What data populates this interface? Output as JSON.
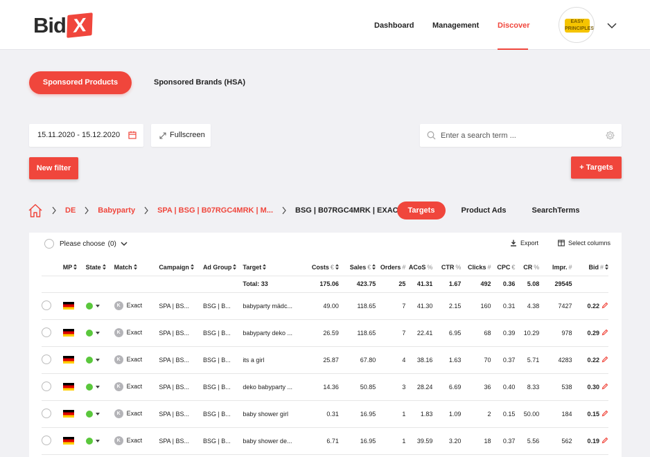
{
  "brand": {
    "name": "Bid",
    "mark": "X"
  },
  "nav": {
    "dashboard": "Dashboard",
    "management": "Management",
    "discover": "Discover"
  },
  "avatar": {
    "label": "EASY PRINCIPLES"
  },
  "pills": {
    "sponsored_products": "Sponsored Products",
    "sponsored_brands": "Sponsored Brands (HSA)"
  },
  "filters": {
    "date_range": "15.11.2020 - 15.12.2020",
    "fullscreen": "Fullscreen"
  },
  "search": {
    "placeholder": "Enter a search term ..."
  },
  "buttons": {
    "new_filter": "New filter",
    "add_targets": "+ Targets"
  },
  "breadcrumb": [
    "DE",
    "Babyparty",
    "SPA | BSG | B07RGC4MRK | M...",
    "BSG | B07RGC4MRK | EXACT"
  ],
  "tabs": {
    "targets": "Targets",
    "product_ads": "Product Ads",
    "search_terms": "SearchTerms"
  },
  "table_tools": {
    "choose": "Please choose",
    "choose_count": "(0)",
    "export": "Export",
    "select_columns": "Select columns"
  },
  "table": {
    "headers": {
      "mp": "MP",
      "state": "State",
      "match": "Match",
      "campaign": "Campaign",
      "ad_group": "Ad Group",
      "target": "Target",
      "costs": "Costs",
      "costs_unit": "€",
      "sales": "Sales",
      "sales_unit": "€",
      "orders": "Orders",
      "orders_unit": "#",
      "acos": "ACoS",
      "acos_unit": "%",
      "ctr": "CTR",
      "ctr_unit": "%",
      "clicks": "Clicks",
      "clicks_unit": "#",
      "cpc": "CPC",
      "cpc_unit": "€",
      "cr": "CR",
      "cr_unit": "%",
      "impr": "Impr.",
      "impr_unit": "#",
      "bid": "Bid",
      "bid_unit": "#"
    },
    "total": {
      "label": "Total: 33",
      "costs": "175.06",
      "sales": "423.75",
      "orders": "25",
      "acos": "41.31",
      "ctr": "1.67",
      "clicks": "492",
      "cpc": "0.36",
      "cr": "5.08",
      "impr": "29545"
    },
    "rows": [
      {
        "match_badge": "K",
        "match": "Exact",
        "campaign": "SPA | BS...",
        "ad_group": "BSG | B...",
        "target": "babyparty mädc...",
        "costs": "49.00",
        "sales": "118.65",
        "orders": "7",
        "acos": "41.30",
        "ctr": "2.15",
        "clicks": "160",
        "cpc": "0.31",
        "cr": "4.38",
        "impr": "7427",
        "bid": "0.22"
      },
      {
        "match_badge": "K",
        "match": "Exact",
        "campaign": "SPA | BS...",
        "ad_group": "BSG | B...",
        "target": "babyparty deko ...",
        "costs": "26.59",
        "sales": "118.65",
        "orders": "7",
        "acos": "22.41",
        "ctr": "6.95",
        "clicks": "68",
        "cpc": "0.39",
        "cr": "10.29",
        "impr": "978",
        "bid": "0.29"
      },
      {
        "match_badge": "K",
        "match": "Exact",
        "campaign": "SPA | BS...",
        "ad_group": "BSG | B...",
        "target": "its a girl",
        "costs": "25.87",
        "sales": "67.80",
        "orders": "4",
        "acos": "38.16",
        "ctr": "1.63",
        "clicks": "70",
        "cpc": "0.37",
        "cr": "5.71",
        "impr": "4283",
        "bid": "0.22"
      },
      {
        "match_badge": "K",
        "match": "Exact",
        "campaign": "SPA | BS...",
        "ad_group": "BSG | B...",
        "target": "deko babyparty ...",
        "costs": "14.36",
        "sales": "50.85",
        "orders": "3",
        "acos": "28.24",
        "ctr": "6.69",
        "clicks": "36",
        "cpc": "0.40",
        "cr": "8.33",
        "impr": "538",
        "bid": "0.30"
      },
      {
        "match_badge": "K",
        "match": "Exact",
        "campaign": "SPA | BS...",
        "ad_group": "BSG | B...",
        "target": "baby shower girl",
        "costs": "0.31",
        "sales": "16.95",
        "orders": "1",
        "acos": "1.83",
        "ctr": "1.09",
        "clicks": "2",
        "cpc": "0.15",
        "cr": "50.00",
        "impr": "184",
        "bid": "0.15"
      },
      {
        "match_badge": "K",
        "match": "Exact",
        "campaign": "SPA | BS...",
        "ad_group": "BSG | B...",
        "target": "baby shower de...",
        "costs": "6.71",
        "sales": "16.95",
        "orders": "1",
        "acos": "39.59",
        "ctr": "3.20",
        "clicks": "18",
        "cpc": "0.37",
        "cr": "5.56",
        "impr": "562",
        "bid": "0.19"
      }
    ]
  },
  "colors": {
    "accent": "#f0463c",
    "active_state": "#5ac73c",
    "background": "#f1f1f4"
  }
}
